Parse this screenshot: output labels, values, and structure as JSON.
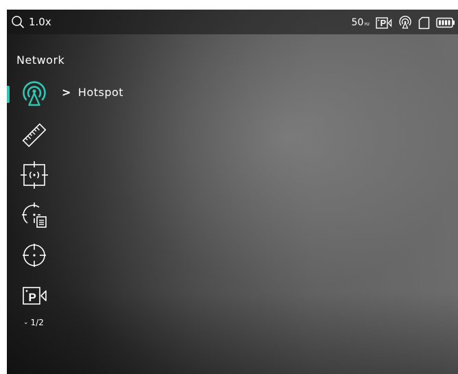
{
  "status_bar": {
    "zoom_icon": "magnifier-icon",
    "zoom_value": "1.0x",
    "refresh_rate": "50",
    "refresh_unit": "Hz",
    "icons": [
      "refresh-rate-icon",
      "picture-in-picture-icon",
      "hotspot-icon",
      "sd-card-icon",
      "battery-icon"
    ]
  },
  "menu": {
    "title": "Network",
    "accent_color": "#2fc7b3",
    "items": [
      {
        "icon": "hotspot-icon",
        "selected": true,
        "submenu_label": "Hotspot"
      },
      {
        "icon": "ruler-icon"
      },
      {
        "icon": "focus-target-icon"
      },
      {
        "icon": "reticle-settings-icon"
      },
      {
        "icon": "crosshair-icon"
      },
      {
        "icon": "picture-in-picture-icon"
      }
    ],
    "page_indicator": "1/2"
  }
}
